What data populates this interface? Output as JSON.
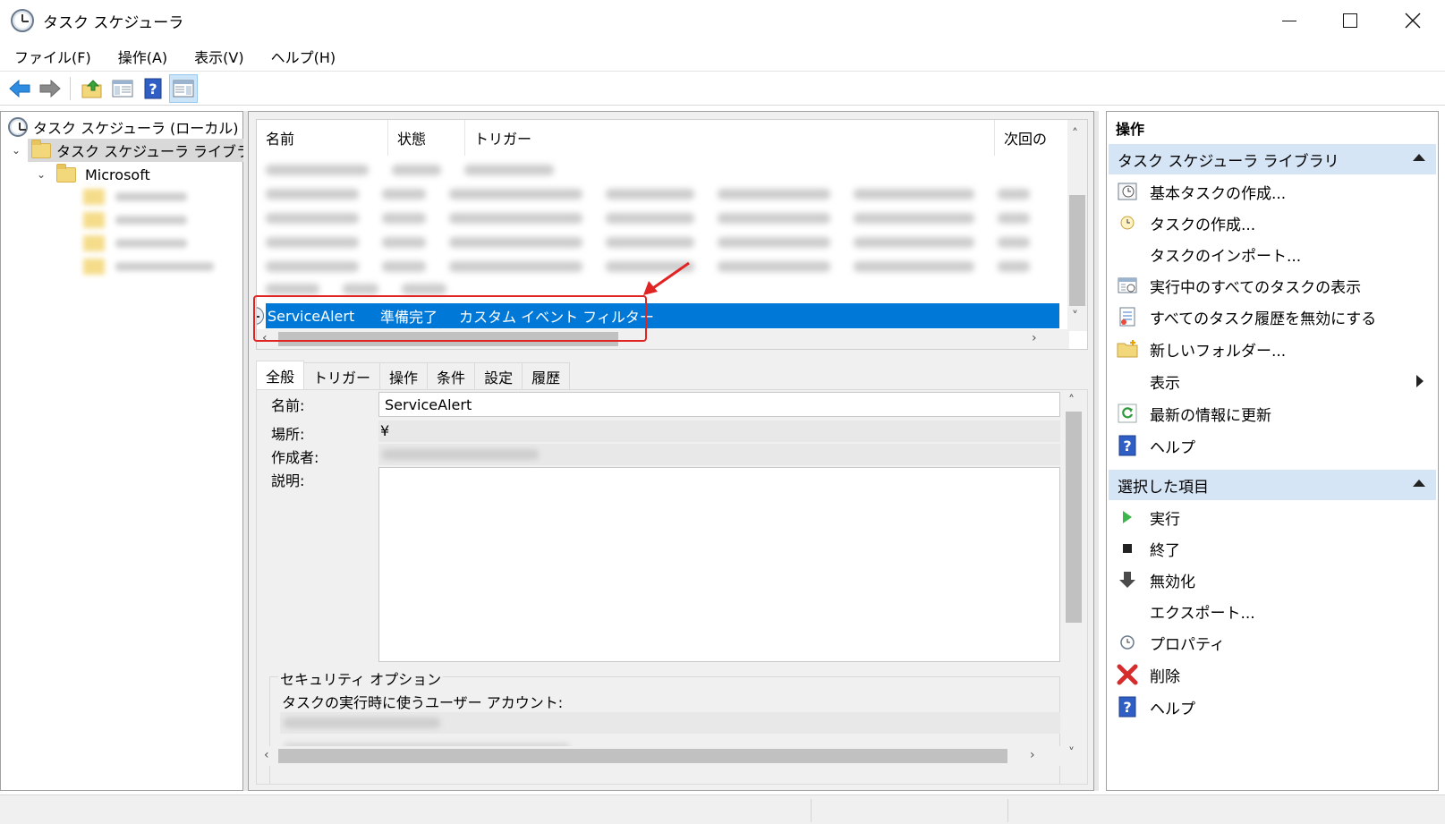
{
  "window": {
    "title": "タスク スケジューラ"
  },
  "menu": [
    "ファイル(F)",
    "操作(A)",
    "表示(V)",
    "ヘルプ(H)"
  ],
  "toolbar": {
    "icons": [
      "back-arrow-icon",
      "forward-arrow-icon",
      "folder-up-icon",
      "show-hide-console-tree-icon",
      "help-icon",
      "show-hide-action-pane-icon"
    ]
  },
  "tree": {
    "root": "タスク スケジューラ (ローカル)",
    "library": "タスク スケジューラ ライブラリ",
    "microsoft": "Microsoft"
  },
  "task_list": {
    "columns": [
      "名前",
      "状態",
      "トリガー",
      "次回の"
    ],
    "selected": {
      "name": "ServiceAlert",
      "status": "準備完了",
      "trigger": "カスタム イベント フィルター"
    }
  },
  "details": {
    "tabs": [
      "全般",
      "トリガー",
      "操作",
      "条件",
      "設定",
      "履歴"
    ],
    "name_label": "名前:",
    "name_value": "ServiceAlert",
    "location_label": "場所:",
    "location_value": "¥",
    "author_label": "作成者:",
    "description_label": "説明:",
    "security_group": "セキュリティ オプション",
    "run_as_label": "タスクの実行時に使うユーザー アカウント:"
  },
  "actions": {
    "header": "操作",
    "section1": {
      "title": "タスク スケジューラ ライブラリ",
      "items": [
        {
          "label": "基本タスクの作成...",
          "icon": "basic-task-wizard-icon"
        },
        {
          "label": "タスクの作成...",
          "icon": "create-task-icon"
        },
        {
          "label": "タスクのインポート...",
          "icon": ""
        },
        {
          "label": "実行中のすべてのタスクの表示",
          "icon": "running-tasks-icon"
        },
        {
          "label": "すべてのタスク履歴を無効にする",
          "icon": "task-history-icon"
        },
        {
          "label": "新しいフォルダー...",
          "icon": "new-folder-icon"
        },
        {
          "label": "表示",
          "icon": ""
        },
        {
          "label": "最新の情報に更新",
          "icon": "refresh-icon"
        },
        {
          "label": "ヘルプ",
          "icon": "help-icon"
        }
      ]
    },
    "section2": {
      "title": "選択した項目",
      "items": [
        {
          "label": "実行",
          "icon": "run-icon"
        },
        {
          "label": "終了",
          "icon": "stop-icon"
        },
        {
          "label": "無効化",
          "icon": "disable-icon"
        },
        {
          "label": "エクスポート...",
          "icon": ""
        },
        {
          "label": "プロパティ",
          "icon": "properties-icon"
        },
        {
          "label": "削除",
          "icon": "delete-icon"
        },
        {
          "label": "ヘルプ",
          "icon": "help-icon"
        }
      ]
    }
  },
  "colors": {
    "selection": "#0078d7",
    "section_header": "#d6e5f5",
    "annotation": "#e02424"
  }
}
